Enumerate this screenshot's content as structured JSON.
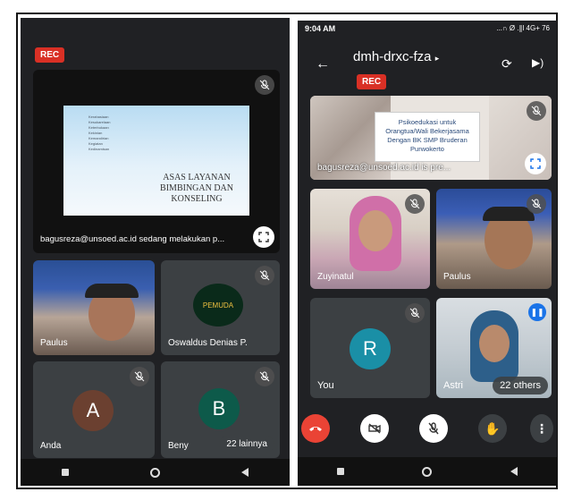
{
  "left_phone": {
    "rec_label": "REC",
    "slide": {
      "bullets": [
        "Kerahasiaan",
        "Kesukarelaan",
        "Keterbukaan",
        "Kekinian",
        "Kemandirian",
        "Kegiatan",
        "Kedinamisan"
      ],
      "title_line1": "ASAS LAYANAN",
      "title_line2": "BIMBINGAN DAN",
      "title_line3": "KONSELING"
    },
    "presenter_caption": "bagusreza@unsoed.ac.id sedang melakukan p...",
    "tiles": [
      {
        "name": "Paulus"
      },
      {
        "name": "Oswaldus Denias P."
      },
      {
        "name": "Anda",
        "initial": "A"
      },
      {
        "name": "Beny",
        "initial": "B"
      }
    ],
    "others_label": "22 lainnya",
    "logo_text": "PEMUDA"
  },
  "right_phone": {
    "status_time": "9:04 AM",
    "status_icons": "...∩ Ø .∥l 4G+ 76",
    "meeting_code": "dmh-drxc-fza",
    "rec_label": "REC",
    "slide": {
      "line1": "Psikoedukasi untuk",
      "line2": "Orangtua/Wali Bekerjasama",
      "line3": "Dengan BK SMP Bruderan",
      "line4": "Purwokerto"
    },
    "presenter_caption": "bagusreza@unsoed.ac.id is pre...",
    "tiles": [
      {
        "name": "Zuyinatul"
      },
      {
        "name": "Paulus"
      },
      {
        "name": "You",
        "initial": "R"
      },
      {
        "name": "Astri"
      }
    ],
    "others_label": "22 others"
  },
  "colors": {
    "rec": "#d93025",
    "tile_bg": "#3c4043",
    "avatar_a": "#6b4030",
    "avatar_b": "#0d5a4a",
    "avatar_r": "#1a8fa6",
    "end_call": "#ea4335"
  }
}
